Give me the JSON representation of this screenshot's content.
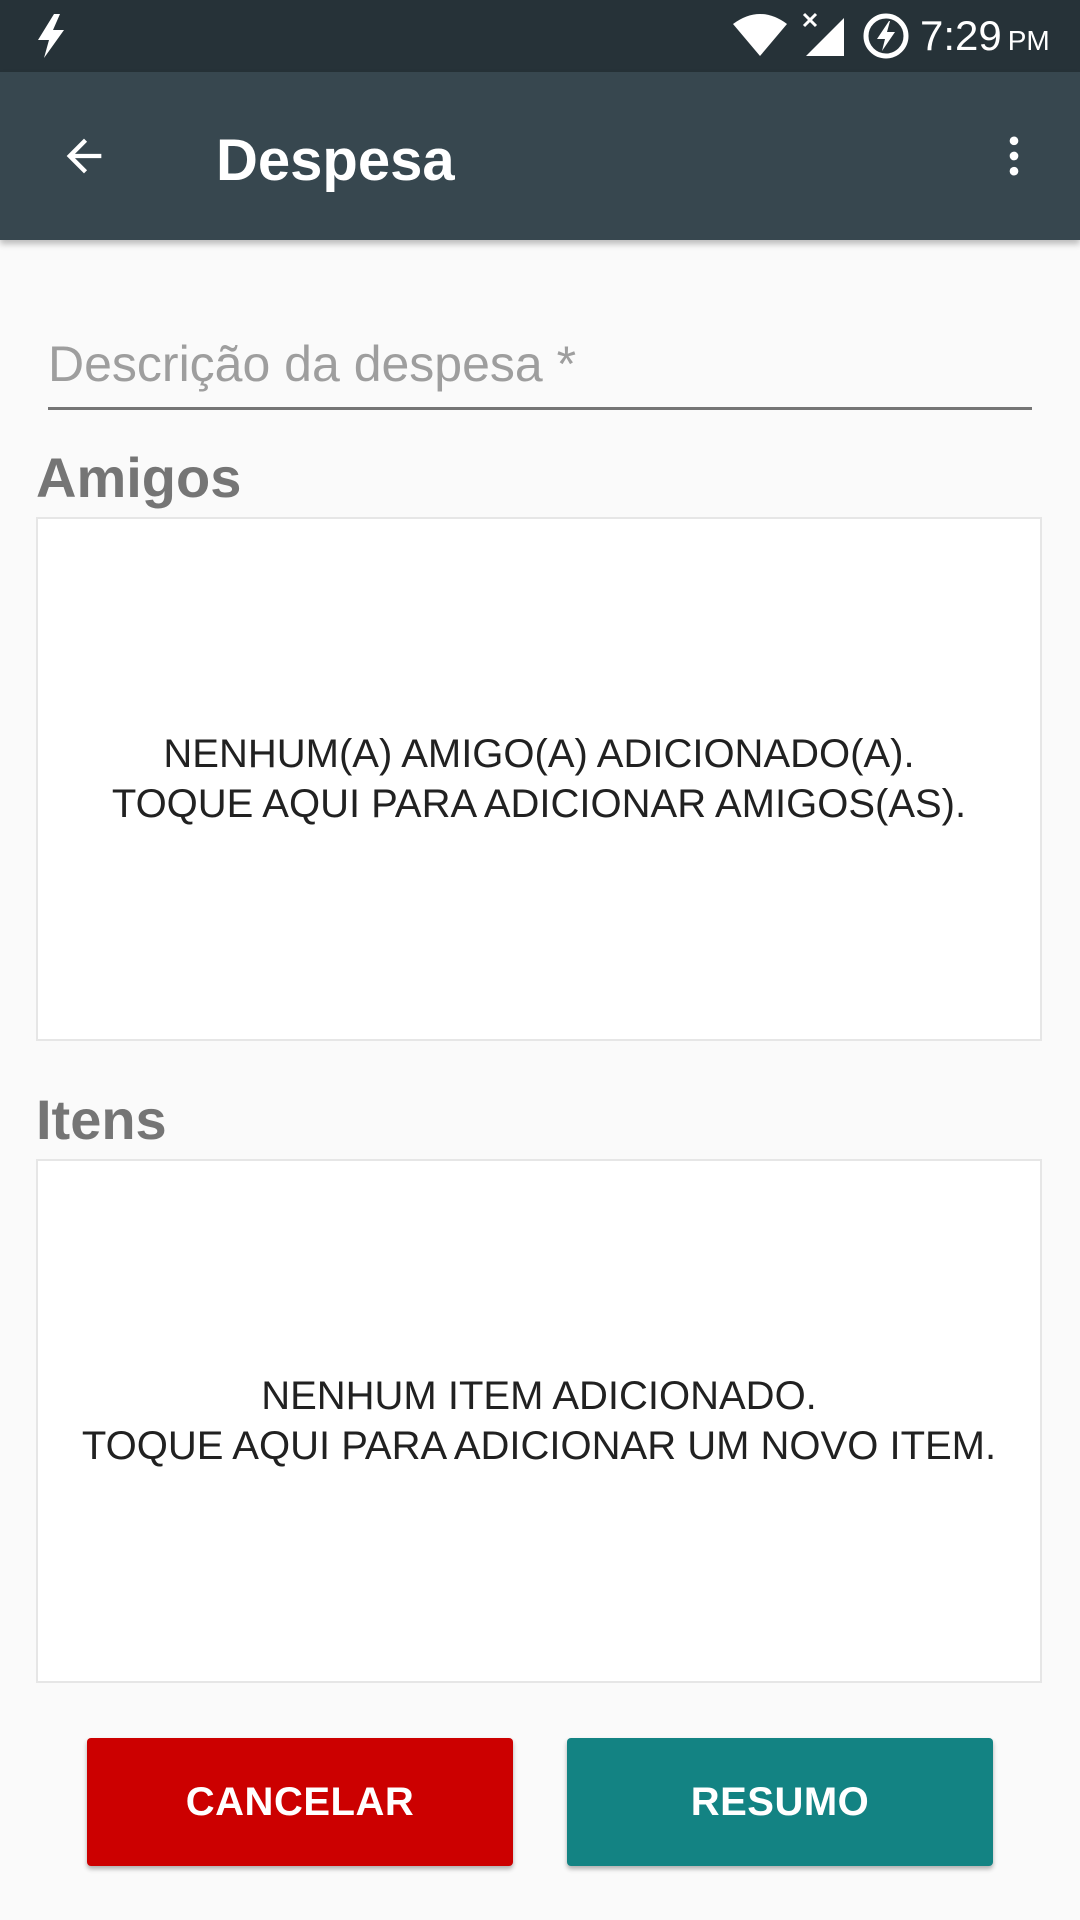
{
  "status_bar": {
    "time": "7:29",
    "ampm": "PM",
    "icons": [
      "flash-icon",
      "wifi-icon",
      "signal-no-service-icon",
      "battery-charging-icon"
    ]
  },
  "app_bar": {
    "title": "Despesa",
    "back_icon": "arrow-left-icon",
    "overflow_icon": "more-vert-icon"
  },
  "form": {
    "description_placeholder": "Descrição da despesa *",
    "description_value": ""
  },
  "friends_section": {
    "title": "Amigos",
    "empty_line1": "NENHUM(A) AMIGO(A) ADICIONADO(A).",
    "empty_line2": "TOQUE AQUI PARA ADICIONAR AMIGOS(AS)."
  },
  "items_section": {
    "title": "Itens",
    "empty_line1": "NENHUM ITEM ADICIONADO.",
    "empty_line2": "TOQUE AQUI PARA ADICIONAR UM NOVO ITEM."
  },
  "actions": {
    "cancel_label": "CANCELAR",
    "summary_label": "RESUMO"
  },
  "colors": {
    "status_bar": "#263238",
    "app_bar": "#37474f",
    "cancel": "#cc0000",
    "summary": "#138383",
    "background": "#fafafa"
  }
}
